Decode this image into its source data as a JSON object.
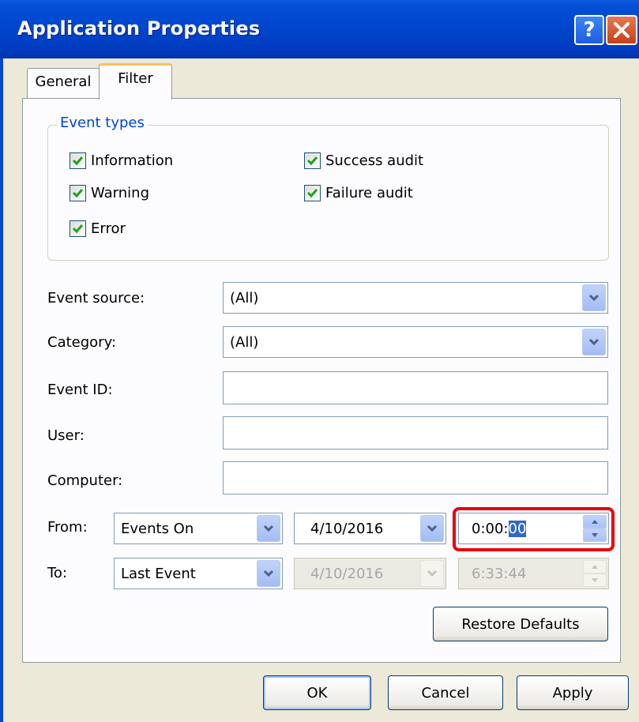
{
  "window": {
    "title": "Application Properties"
  },
  "tabs": [
    {
      "label": "General",
      "active": false
    },
    {
      "label": "Filter",
      "active": true
    }
  ],
  "event_types": {
    "legend": "Event types",
    "items": [
      {
        "label": "Information",
        "checked": true
      },
      {
        "label": "Warning",
        "checked": true
      },
      {
        "label": "Error",
        "checked": true
      },
      {
        "label": "Success audit",
        "checked": true
      },
      {
        "label": "Failure audit",
        "checked": true
      }
    ]
  },
  "fields": {
    "event_source": {
      "label": "Event source:",
      "value": "(All)"
    },
    "category": {
      "label": "Category:",
      "value": "(All)"
    },
    "event_id": {
      "label": "Event ID:",
      "value": ""
    },
    "user": {
      "label": "User:",
      "value": ""
    },
    "computer": {
      "label": "Computer:",
      "value": ""
    }
  },
  "from": {
    "label": "From:",
    "mode": "Events On",
    "date": "4/10/2016",
    "time_prefix": "0:00:",
    "time_selected": "00"
  },
  "to": {
    "label": "To:",
    "mode": "Last Event",
    "date": "4/10/2016",
    "time": "6:33:44"
  },
  "buttons": {
    "restore_defaults": "Restore Defaults",
    "ok": "OK",
    "cancel": "Cancel",
    "apply": "Apply"
  },
  "icons": {
    "help": "help-icon",
    "close": "close-icon",
    "check": "checkmark-icon",
    "dropdown": "chevron-down-icon",
    "spin_up": "spin-up-icon",
    "spin_down": "spin-down-icon"
  },
  "colors": {
    "titlebar": "#0047cf",
    "legend_text": "#0046d5",
    "highlight": "#e8000b",
    "check_mark": "#21a121"
  }
}
